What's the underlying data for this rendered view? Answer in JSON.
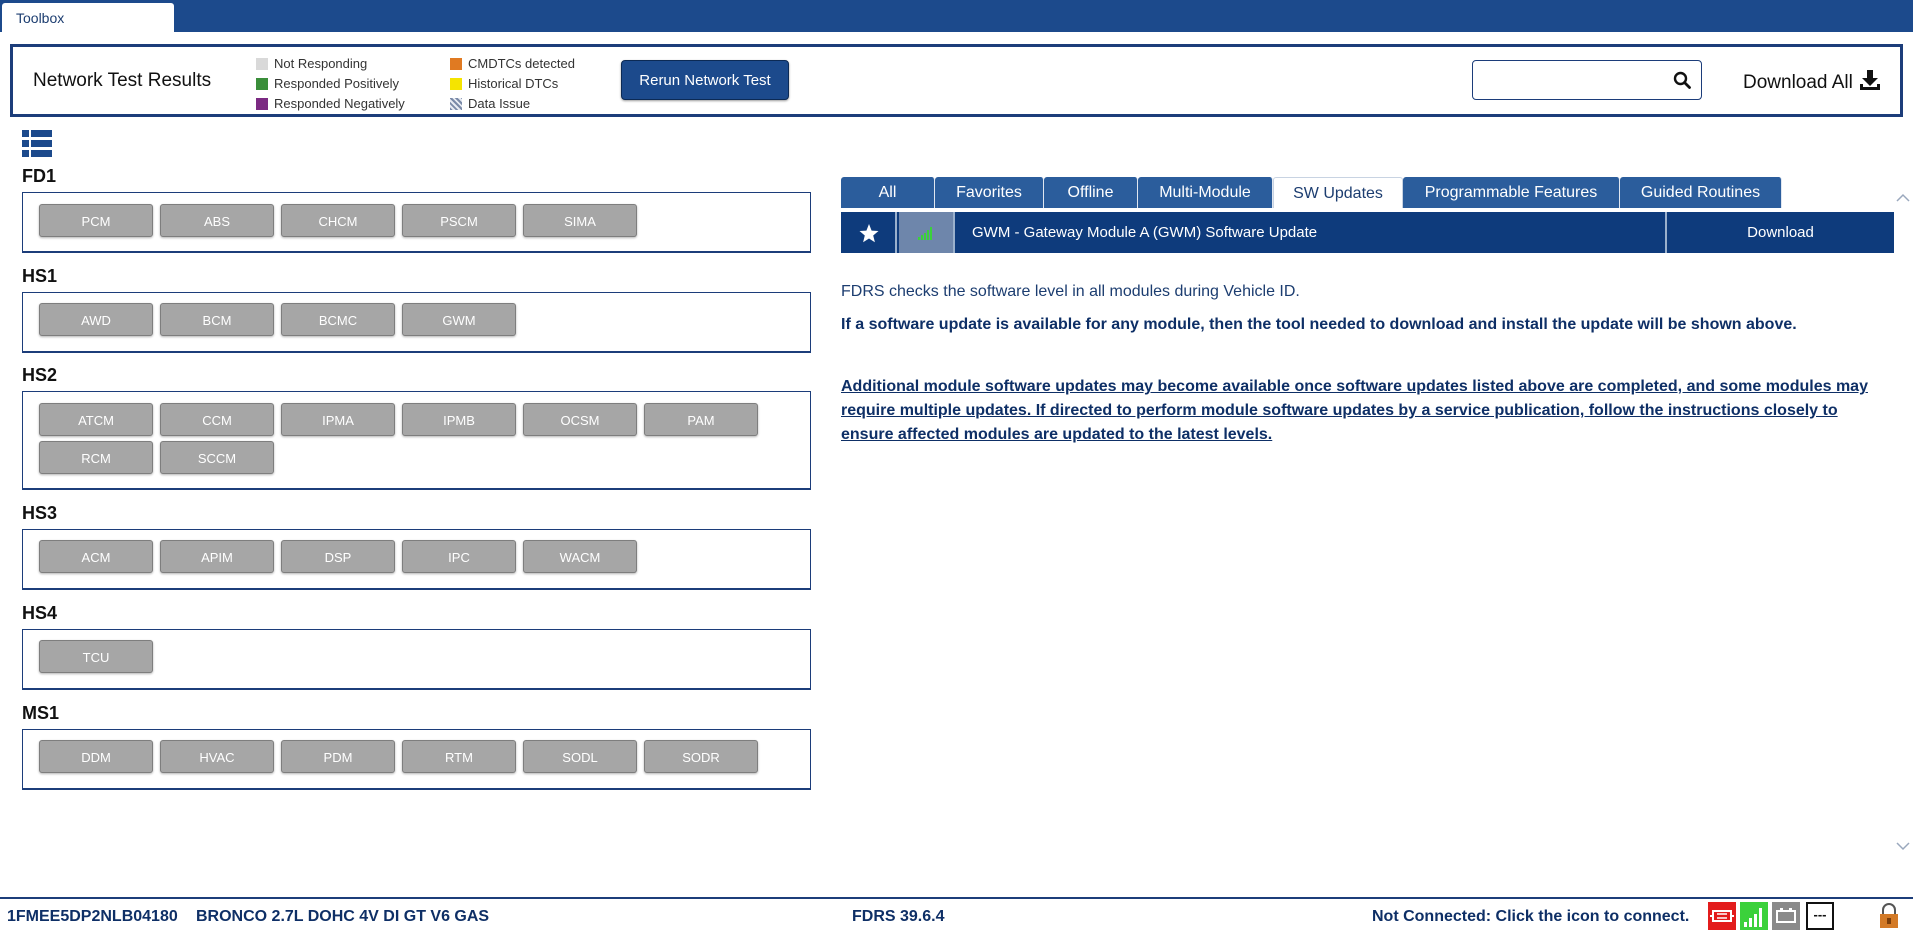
{
  "window": {
    "tab_label": "Toolbox"
  },
  "header": {
    "title": "Network Test Results",
    "legend": [
      {
        "label": "Not Responding",
        "color": "#d9d9d9"
      },
      {
        "label": "Responded Positively",
        "color": "#3a8e3a"
      },
      {
        "label": "Responded Negatively",
        "color": "#7b2a82"
      },
      {
        "label": "CMDTCs detected",
        "color": "#e07a22"
      },
      {
        "label": "Historical DTCs",
        "color": "#f5e400"
      },
      {
        "label": "Data Issue",
        "color": "hatched"
      }
    ],
    "rerun_label": "Rerun Network Test",
    "search": {
      "value": "",
      "placeholder": ""
    },
    "download_all_label": "Download All"
  },
  "groups": [
    {
      "name": "FD1",
      "modules": [
        "PCM",
        "ABS",
        "CHCM",
        "PSCM",
        "SIMA"
      ]
    },
    {
      "name": "HS1",
      "modules": [
        "AWD",
        "BCM",
        "BCMC",
        "GWM"
      ]
    },
    {
      "name": "HS2",
      "modules": [
        "ATCM",
        "CCM",
        "IPMA",
        "IPMB",
        "OCSM",
        "PAM",
        "RCM",
        "SCCM"
      ]
    },
    {
      "name": "HS3",
      "modules": [
        "ACM",
        "APIM",
        "DSP",
        "IPC",
        "WACM"
      ]
    },
    {
      "name": "HS4",
      "modules": [
        "TCU"
      ]
    },
    {
      "name": "MS1",
      "modules": [
        "DDM",
        "HVAC",
        "PDM",
        "RTM",
        "SODL",
        "SODR"
      ]
    }
  ],
  "tabs": [
    {
      "label": "All",
      "active": false
    },
    {
      "label": "Favorites",
      "active": false
    },
    {
      "label": "Offline",
      "active": false
    },
    {
      "label": "Multi-Module",
      "active": false
    },
    {
      "label": "SW Updates",
      "active": true
    },
    {
      "label": "Programmable Features",
      "active": false
    },
    {
      "label": "Guided Routines",
      "active": false
    }
  ],
  "update": {
    "title": "GWM - Gateway Module A (GWM) Software Update",
    "download_label": "Download"
  },
  "info": {
    "line1": "FDRS checks the software level in all modules during Vehicle ID.",
    "line2": "If a software update is available for any module, then the tool needed to download and install the update will be shown above.",
    "line3": "Additional module software updates may become available once software updates listed above are completed, and some modules may require multiple updates. If directed to perform module software updates by a service publication, follow the instructions closely to ensure affected modules are updated to the latest levels."
  },
  "status": {
    "vin": "1FMEE5DP2NLB04180",
    "vehicle": "BRONCO 2.7L DOHC 4V DI GT V6 GAS",
    "fdrs_version": "FDRS 39.6.4",
    "connection": "Not Connected: Click the icon to connect.",
    "dash": "---"
  },
  "colors": {
    "brand_blue": "#1c4a8c",
    "dark_blue": "#0e3b7c",
    "module_gray": "#a6a6a6",
    "signal_green": "#3bd13b",
    "disconnect_red": "#e31c1c"
  }
}
